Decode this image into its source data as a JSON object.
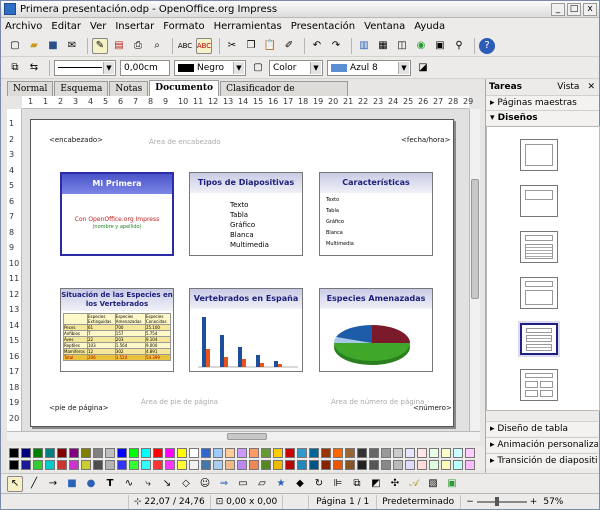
{
  "window": {
    "title": "Primera presentación.odp - OpenOffice.org Impress",
    "min": "_",
    "max": "□",
    "close": "x"
  },
  "menu": [
    "Archivo",
    "Editar",
    "Ver",
    "Insertar",
    "Formato",
    "Herramientas",
    "Presentación",
    "Ventana",
    "Ayuda"
  ],
  "toolbar2": {
    "line_width": "0,00cm",
    "line_color": "Negro",
    "fill_type": "Color",
    "fill_color": "Azul 8"
  },
  "tabs": [
    "Normal",
    "Esquema",
    "Notas",
    "Documento",
    "Clasificador de diapositivas"
  ],
  "ruler_h": [
    "1",
    "1",
    "2",
    "3",
    "4",
    "5",
    "6",
    "7",
    "8",
    "9",
    "10",
    "11",
    "12",
    "13",
    "14",
    "15",
    "16",
    "17",
    "18",
    "19",
    "20",
    "21",
    "22",
    "23",
    "24",
    "25",
    "26",
    "27",
    "28",
    "29"
  ],
  "ruler_v": [
    "1",
    "2",
    "3",
    "4",
    "5",
    "6",
    "7",
    "8",
    "9",
    "10",
    "11",
    "12",
    "13",
    "14",
    "15",
    "16",
    "17",
    "18",
    "19",
    "20"
  ],
  "page": {
    "header_left": "<encabezado>",
    "header_mid": "Área de encabezado",
    "header_right": "<fecha/hora>",
    "footer_left": "<pie de página>",
    "footer_mid": "Área de pie de página",
    "footer_mid2": "Área de número de página",
    "footer_right": "<número>"
  },
  "slides": [
    {
      "title": "Mi Primera Presentación",
      "line1": "Con OpenOffice.org Impress",
      "line2": "(nombre y apellido)"
    },
    {
      "title": "Tipos de Diapositivas",
      "bullets": [
        "Texto",
        "Tabla",
        "Gráfico",
        "Blanca",
        "Multimedia"
      ]
    },
    {
      "title": "Características",
      "bullets": [
        "Texto",
        "Tabla",
        "Gráfico",
        "Blanca",
        "Multimedia"
      ]
    },
    {
      "title": "Situación de las Especies en los Vertebrados",
      "rows": [
        "Peces",
        "Anfibios",
        "Aves",
        "Reptiles",
        "Mamíferos",
        "Total"
      ],
      "cols": [
        "Especies Extinguidas",
        "Especies Amenazadas",
        "Especies Conocidas"
      ],
      "values": [
        [
          "61",
          "700",
          "25.100"
        ],
        [
          "7",
          "157",
          "5.754"
        ],
        [
          "22",
          "203",
          "9.104"
        ],
        [
          "103",
          "1.564",
          "9.000"
        ],
        [
          "12",
          "302",
          "4.891"
        ],
        [
          "206",
          "3.524",
          "54.399"
        ]
      ]
    },
    {
      "title": "Vertebrados en España"
    },
    {
      "title": "Especies Amenazadas"
    }
  ],
  "right_panel": {
    "header": "Tareas",
    "view": "Vista",
    "sections": [
      "Páginas maestras",
      "Diseños",
      "Diseño de tabla",
      "Animación personalizada",
      "Transición de diapositiva"
    ]
  },
  "status": {
    "position": "22,07 / 24,76",
    "size": "0,00 x 0,00",
    "page": "Página 1 / 1",
    "master": "Predeterminado",
    "zoom": "57%"
  },
  "palette": [
    "#000000",
    "#000080",
    "#008000",
    "#008080",
    "#800000",
    "#800080",
    "#808000",
    "#808080",
    "#c0c0c0",
    "#0000ff",
    "#00ff00",
    "#00ffff",
    "#ff0000",
    "#ff00ff",
    "#ffff00",
    "#ffffff",
    "#3366cc",
    "#99ccff",
    "#ffcc99",
    "#cc99ff",
    "#ff9966",
    "#669933",
    "#ffcc00",
    "#cc0000",
    "#3399cc",
    "#006699",
    "#993300",
    "#ff6600",
    "#996633",
    "#333333",
    "#666666",
    "#999999",
    "#cccccc",
    "#e6e6ff",
    "#ffe6e6",
    "#e6ffe6",
    "#ffffcc",
    "#ccffff",
    "#ffccff",
    "#000000",
    "#1a1a99",
    "#33cc33",
    "#00cccc",
    "#cc3333",
    "#cc33cc",
    "#cccc33",
    "#4d4d4d",
    "#b3b3b3",
    "#3333ff",
    "#33ff33",
    "#33ffff",
    "#ff3333",
    "#ff33ff",
    "#ffff33",
    "#f2f2f2",
    "#4477aa",
    "#aaccee",
    "#eebb88",
    "#bb88ee",
    "#ee8855",
    "#558822",
    "#eebb00",
    "#bb0000",
    "#2288bb",
    "#005588",
    "#882200",
    "#ee5500",
    "#885522",
    "#222222",
    "#555555",
    "#888888",
    "#bbbbbb",
    "#ddddff",
    "#ffdddd",
    "#ddffdd",
    "#ffffbb",
    "#bbffff",
    "#ffbbff"
  ]
}
